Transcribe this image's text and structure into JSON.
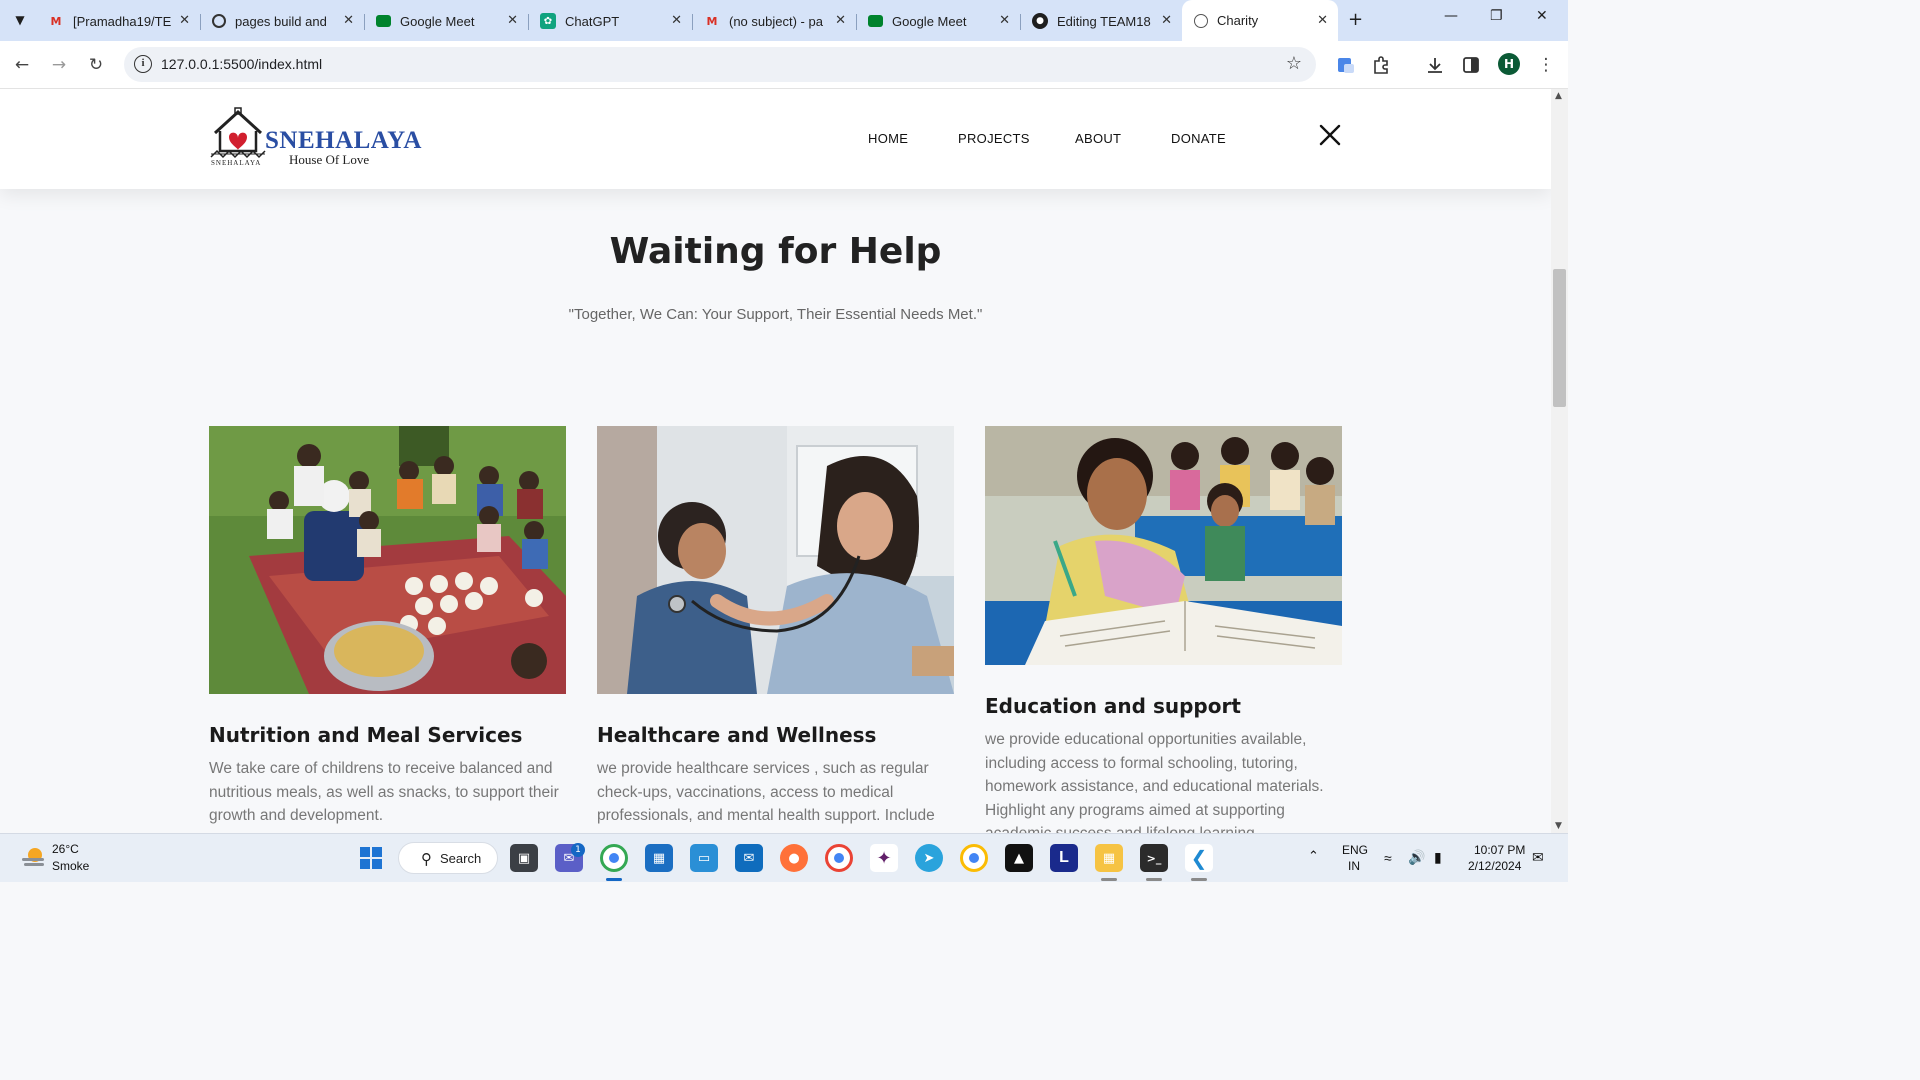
{
  "browser": {
    "tabs": [
      {
        "title": "[Pramadha19/TE",
        "icon": "gmail-icon",
        "active": false
      },
      {
        "title": "pages build and",
        "icon": "github-actions-icon",
        "active": false
      },
      {
        "title": "Google Meet",
        "icon": "google-meet-icon",
        "active": false
      },
      {
        "title": "ChatGPT",
        "icon": "chatgpt-icon",
        "active": false
      },
      {
        "title": "(no subject) - pa",
        "icon": "gmail-icon",
        "active": false
      },
      {
        "title": "Google Meet",
        "icon": "google-meet-icon",
        "active": false
      },
      {
        "title": "Editing TEAM18",
        "icon": "github-icon",
        "active": false
      },
      {
        "title": "Charity",
        "icon": "globe-icon",
        "active": true
      }
    ],
    "url": "127.0.0.1:5500/index.html",
    "profile_initial": "H"
  },
  "site": {
    "logo": {
      "brand": "SNEHALAYA",
      "tagline": "House Of Love",
      "small": "SNEHALAYA"
    },
    "nav": [
      "HOME",
      "PROJECTS",
      "ABOUT",
      "DONATE"
    ],
    "section_title": "Waiting for Help",
    "section_subtitle": "\"Together, We Can: Your Support, Their Essential Needs Met.\"",
    "cards": [
      {
        "title": "Nutrition and Meal Services",
        "text": "We take care of childrens to receive balanced and nutritious meals, as well as snacks, to support their growth and development.",
        "image": "children-eating-meal-photo"
      },
      {
        "title": "Healthcare and Wellness",
        "text": "we provide healthcare services , such as regular check-ups, vaccinations, access to medical professionals, and mental health support. Include",
        "image": "doctor-examining-child-photo"
      },
      {
        "title": "Education and support",
        "text": "we provide educational opportunities available, including access to formal schooling, tutoring, homework assistance, and educational materials. Highlight any programs aimed at supporting academic success and lifelong learning.",
        "image": "girl-studying-classroom-photo"
      }
    ]
  },
  "taskbar": {
    "weather": {
      "temp": "26°C",
      "condition": "Smoke"
    },
    "search_label": "Search",
    "teams_badge": "1",
    "language": "ENG",
    "region": "IN",
    "time": "10:07 PM",
    "date": "2/12/2024"
  }
}
